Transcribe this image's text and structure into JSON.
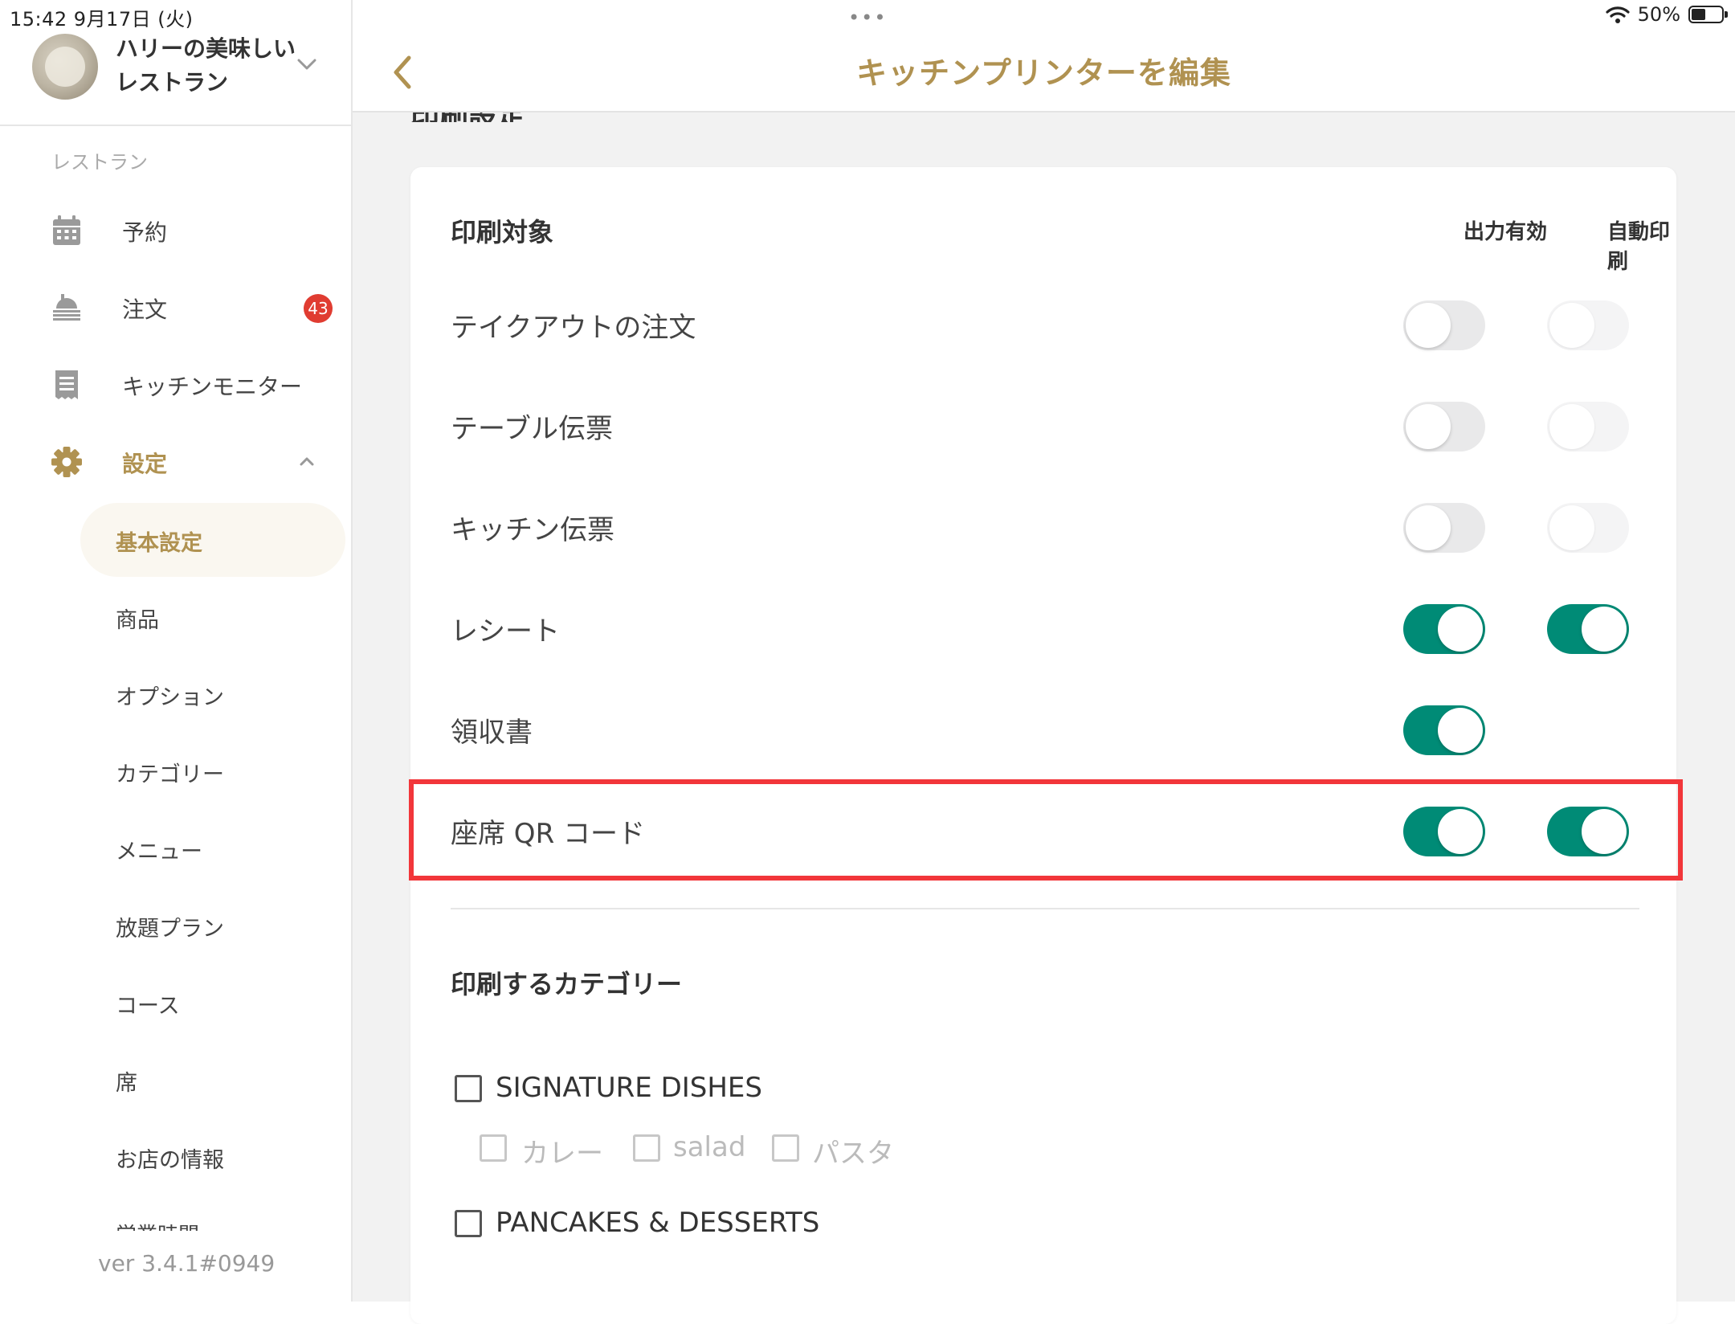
{
  "status_bar": {
    "time_date": "15:42   9月17日 (火)",
    "dots": "•••",
    "battery_text": "50%",
    "battery_level": 0.5
  },
  "sidebar": {
    "restaurant_name": "ハリーの美味しいレストラン",
    "section_label": "レストラン",
    "nav": [
      {
        "label": "予約",
        "icon": "calendar-icon"
      },
      {
        "label": "注文",
        "icon": "food-tray-icon",
        "badge": "43"
      },
      {
        "label": "キッチンモニター",
        "icon": "receipt-icon"
      },
      {
        "label": "設定",
        "icon": "gear-icon"
      }
    ],
    "sub_items": [
      "基本設定",
      "商品",
      "オプション",
      "カテゴリー",
      "メニュー",
      "放題プラン",
      "コース",
      "席",
      "お店の情報"
    ],
    "sub_cut": "営業時間",
    "version": "ver 3.4.1#0949"
  },
  "page": {
    "title": "キッチンプリンターを編集",
    "cut_heading": "印刷設定"
  },
  "print_targets": {
    "heading": "印刷対象",
    "col_output": "出力有効",
    "col_auto": "自動印刷",
    "rows": [
      {
        "label": "テイクアウトの注文",
        "output": false,
        "auto": false
      },
      {
        "label": "テーブル伝票",
        "output": false,
        "auto": false
      },
      {
        "label": "キッチン伝票",
        "output": false,
        "auto": false
      },
      {
        "label": "レシート",
        "output": true,
        "auto": true
      },
      {
        "label": "領収書",
        "output": true,
        "auto": null
      },
      {
        "label": "座席 QR コード",
        "output": true,
        "auto": true
      }
    ]
  },
  "categories": {
    "heading": "印刷するカテゴリー",
    "groups": [
      {
        "label": "SIGNATURE DISHES",
        "checked": false,
        "children": [
          {
            "label": "カレー",
            "checked": false
          },
          {
            "label": "salad",
            "checked": false
          },
          {
            "label": "パスタ",
            "checked": false
          }
        ]
      },
      {
        "label": "PANCAKES & DESSERTS",
        "checked": false
      }
    ]
  },
  "colors": {
    "accent_gold": "#b09251",
    "toggle_on": "#008b76",
    "highlight": "#f2363a",
    "badge": "#e03c31"
  }
}
